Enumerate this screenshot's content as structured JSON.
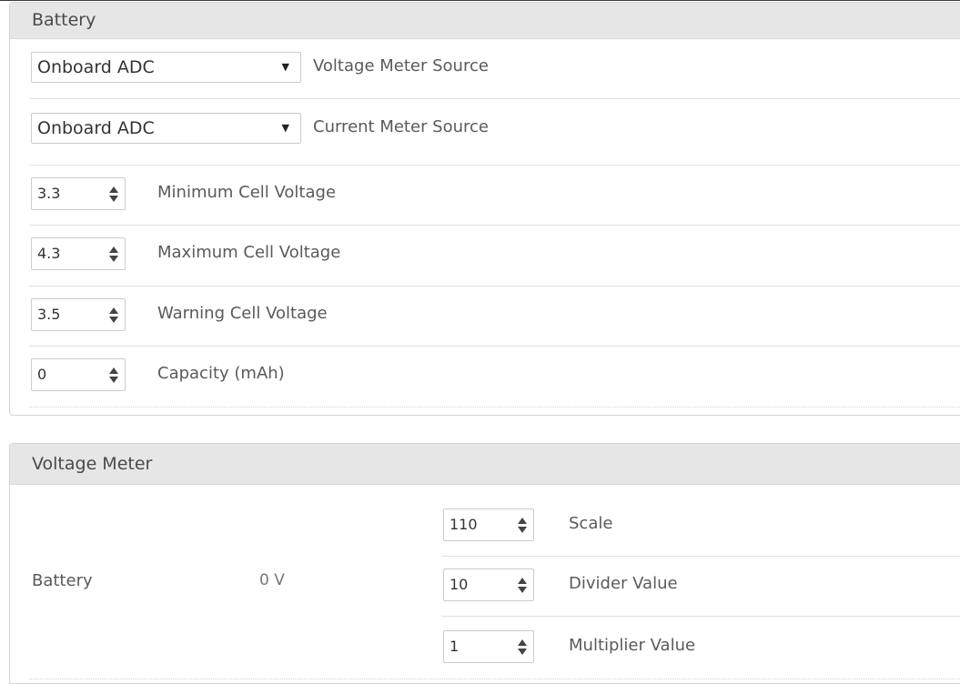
{
  "battery": {
    "title": "Battery",
    "voltage_meter_source": {
      "value": "Onboard ADC",
      "label": "Voltage Meter Source"
    },
    "current_meter_source": {
      "value": "Onboard ADC",
      "label": "Current Meter Source"
    },
    "min_cell_voltage": {
      "value": "3.3",
      "label": "Minimum Cell Voltage"
    },
    "max_cell_voltage": {
      "value": "4.3",
      "label": "Maximum Cell Voltage"
    },
    "warning_cell_voltage": {
      "value": "3.5",
      "label": "Warning Cell Voltage"
    },
    "capacity": {
      "value": "0",
      "label": "Capacity (mAh)"
    }
  },
  "voltage_meter": {
    "title": "Voltage Meter",
    "name": "Battery",
    "reading": "0 V",
    "scale": {
      "value": "110",
      "label": "Scale"
    },
    "divider": {
      "value": "10",
      "label": "Divider Value"
    },
    "multiplier": {
      "value": "1",
      "label": "Multiplier Value"
    }
  },
  "icons": {
    "dropdown": "triangle-down",
    "spinner": "up-down-arrows"
  }
}
